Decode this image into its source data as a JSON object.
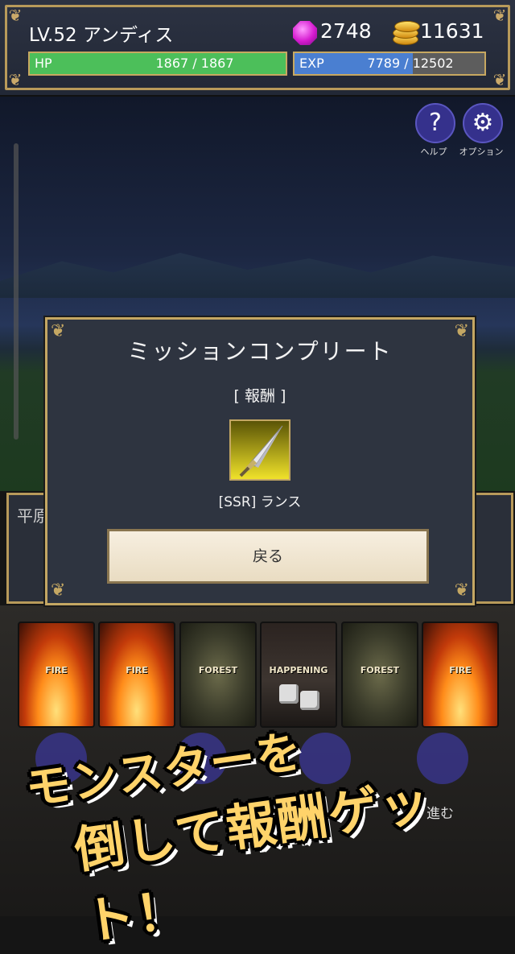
{
  "status": {
    "level_name": "LV.52 アンディス",
    "gems": "2748",
    "coins": "11631",
    "hp": {
      "label": "HP",
      "value": "1867 / 1867",
      "fraction": 1.0,
      "color": "#4cbf5a"
    },
    "exp": {
      "label": "EXP",
      "value": "7789 / 12502",
      "fraction": 0.623,
      "color": "#4a7fd1"
    }
  },
  "top_buttons": [
    {
      "label": "ヘルプ",
      "icon": "question-icon"
    },
    {
      "label": "オプション",
      "icon": "gear-icon"
    }
  ],
  "message": {
    "text": "平原"
  },
  "modal": {
    "title": "ミッションコンプリート",
    "reward_heading": "[ 報酬 ]",
    "item_name": "[SSR] ランス",
    "item_icon": "lance-icon",
    "back_label": "戻る"
  },
  "cards": [
    {
      "label": "FIRE",
      "kind": "fire"
    },
    {
      "label": "FIRE",
      "kind": "fire"
    },
    {
      "label": "FOREST",
      "kind": "forest"
    },
    {
      "label": "HAPPENING",
      "kind": "happening"
    },
    {
      "label": "FOREST",
      "kind": "forest"
    },
    {
      "label": "FIRE",
      "kind": "fire"
    }
  ],
  "actions": {
    "advance_label": "進む"
  },
  "banner": {
    "line1": "モンスターを",
    "line2": "倒して報酬ゲット！"
  }
}
